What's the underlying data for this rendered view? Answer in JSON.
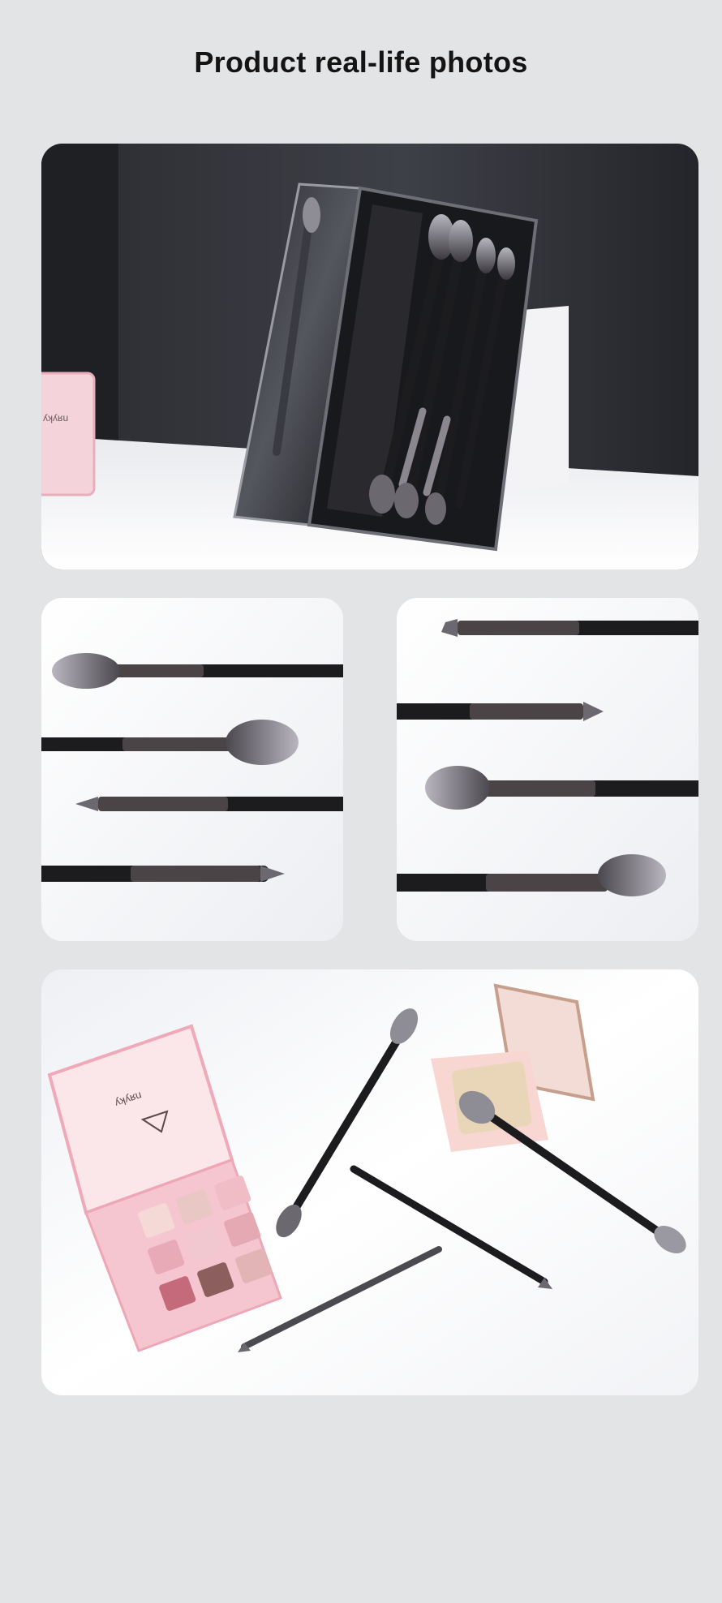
{
  "page": {
    "title": "Product real-life photos"
  },
  "colors": {
    "page_background": "#e3e4e6",
    "title_text": "#141414",
    "brush_handle": "#1c1c1f",
    "brush_ferrule": "#4a4446",
    "bristle_tip": "#8e8c94",
    "palette_pink": "#f3c6cf"
  },
  "photos": [
    {
      "name": "photo-brush-case-open",
      "kind": "real-life product photo"
    },
    {
      "name": "photo-four-brushes-left",
      "kind": "real-life product photo"
    },
    {
      "name": "photo-four-brushes-right",
      "kind": "real-life product photo"
    },
    {
      "name": "photo-brushes-with-palette",
      "kind": "real-life product photo"
    }
  ]
}
